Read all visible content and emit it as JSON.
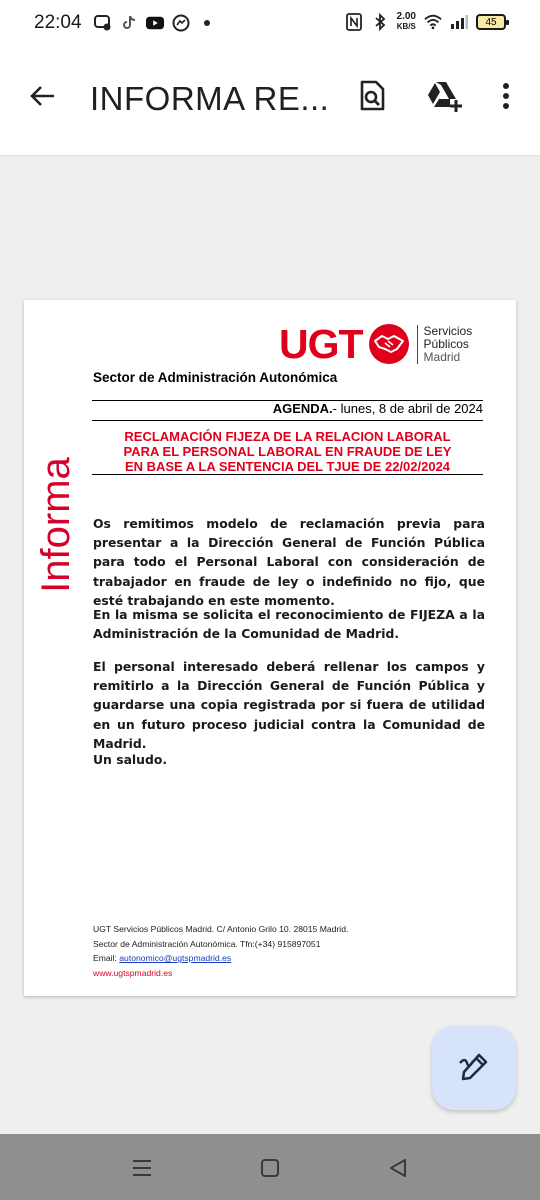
{
  "status_bar": {
    "time": "22:04",
    "net_speed_value": "2.00",
    "net_speed_unit": "KB/S",
    "battery": "45",
    "icons_left": [
      "chat-icon",
      "tiktok-icon",
      "youtube-icon",
      "messenger-icon",
      "dot-icon"
    ],
    "icons_right": [
      "nfc-icon",
      "bluetooth-icon",
      "wifi-icon",
      "signal-icon",
      "battery-icon"
    ]
  },
  "app_bar": {
    "title": "INFORMA RE..."
  },
  "document": {
    "side_label": "Informa",
    "logo": {
      "brand": "UGT",
      "line1": "Servicios",
      "line2": "Públicos",
      "line3": "Madrid"
    },
    "sector": "Sector de Administración Autonómica",
    "agenda_label": "AGENDA.",
    "agenda_date": "- lunes, 8 de abril de 2024",
    "headline": [
      "RECLAMACIÓN FIJEZA DE LA RELACION LABORAL",
      "PARA EL PERSONAL LABORAL EN FRAUDE DE LEY",
      "EN BASE A LA SENTENCIA DEL TJUE DE 22/02/2024"
    ],
    "paragraphs": [
      "Os remitimos modelo de reclamación previa para presentar a la Dirección General de Función Pública para todo el Personal Laboral con consideración de trabajador en fraude de ley o indefinido no fijo, que esté trabajando en este momento.",
      "En la misma se solicita el reconocimiento de FIJEZA a la Administración de la Comunidad de Madrid.",
      "El personal interesado deberá rellenar los campos y remitirlo a la Dirección General de Función Pública y guardarse una copia registrada por si fuera de utilidad en un futuro proceso judicial contra la Comunidad de Madrid.",
      "Un saludo."
    ],
    "footer": {
      "line1": "UGT Servicios Públicos Madrid. C/ Antonio Grilo 10. 28015 Madrid.",
      "line2": "Sector de Administración Autonómica. Tfn:(+34) 915897051",
      "email_label": "Email: ",
      "email": "autonomico@ugtspmadrid.es",
      "web": "www.ugtspmadrid.es"
    }
  },
  "colors": {
    "ugt_red": "#e0001b",
    "fab_bg": "#d7e3fb",
    "nav_bg": "#8f8f8f",
    "page_bg": "#efefef"
  }
}
